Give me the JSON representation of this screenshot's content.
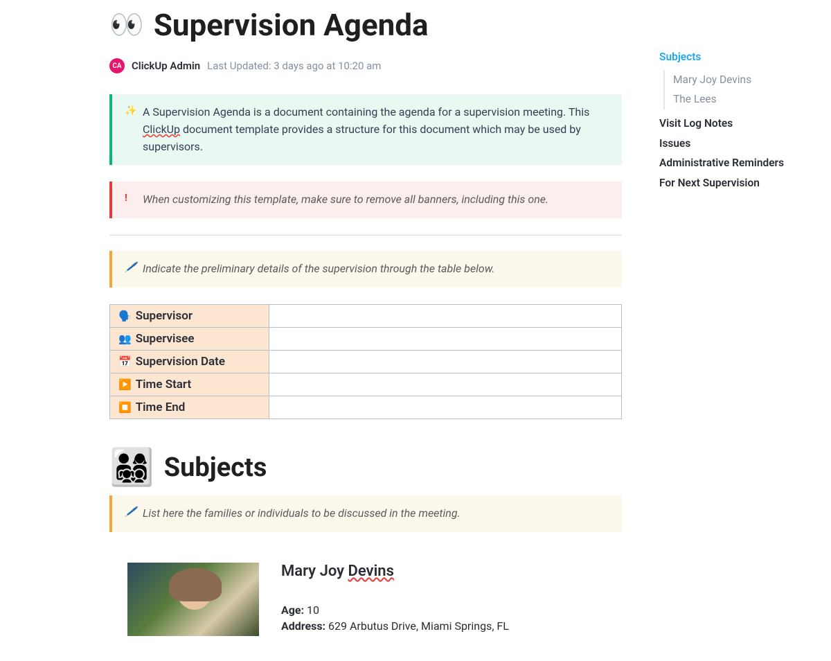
{
  "page": {
    "icon": "👀",
    "title": "Supervision Agenda"
  },
  "author": {
    "initials": "CA",
    "name": "ClickUp Admin",
    "updated_prefix": "Last Updated:",
    "updated": "3 days ago at 10:20 am"
  },
  "banners": {
    "intro_part1": "A Supervision Agenda is a document containing the agenda for a supervision meeting. This ",
    "intro_link": "ClickUp",
    "intro_part2": " document template provides a structure for this document which may be used by supervisors.",
    "warning": "When customizing this template, make sure to remove all banners, including this one.",
    "details_hint": "Indicate the preliminary details of the supervision through the table below.",
    "subjects_hint": "List here the families or individuals to be discussed in the meeting."
  },
  "details_table": {
    "rows": [
      {
        "icon": "🗣️",
        "label": "Supervisor",
        "value": ""
      },
      {
        "icon": "👥",
        "label": "Supervisee",
        "value": ""
      },
      {
        "icon": "📅",
        "label": "Supervision Date",
        "value": ""
      },
      {
        "icon": "▶️",
        "label": "Time Start",
        "value": ""
      },
      {
        "icon": "⏹️",
        "label": "Time End",
        "value": ""
      }
    ]
  },
  "sections": {
    "subjects": {
      "icon": "👨‍👩‍👧‍👦",
      "title": "Subjects"
    }
  },
  "subject": {
    "first_name": "Mary Joy ",
    "last_name": "Devins",
    "age_label": "Age:",
    "age": "10",
    "address_label": "Address:",
    "address": "629 Arbutus Drive, Miami Springs, FL"
  },
  "outline": {
    "items": [
      {
        "label": "Subjects",
        "active": true,
        "children": [
          "Mary Joy Devins",
          "The Lees"
        ]
      },
      {
        "label": "Visit Log Notes"
      },
      {
        "label": "Issues"
      },
      {
        "label": "Administrative Reminders"
      },
      {
        "label": "For Next Supervision"
      }
    ]
  }
}
